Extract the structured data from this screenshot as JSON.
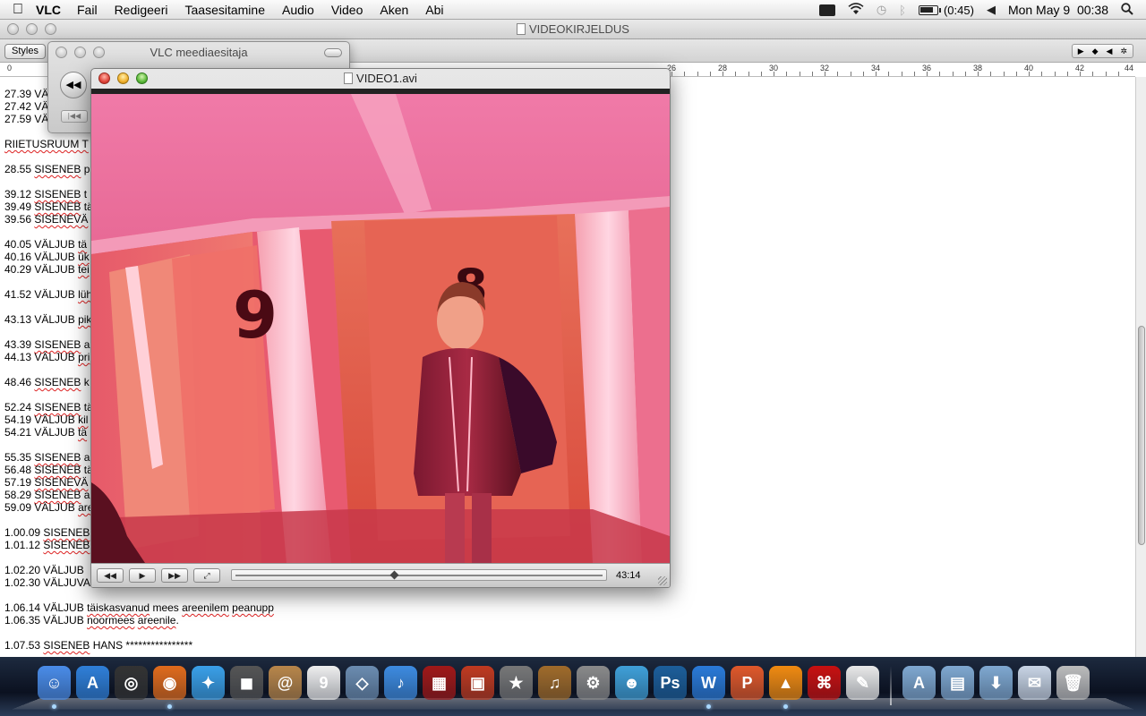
{
  "menubar": {
    "app_name": "VLC",
    "menus": [
      "Fail",
      "Redigeeri",
      "Taasesitamine",
      "Audio",
      "Video",
      "Aken",
      "Abi"
    ],
    "battery": "(0:45)",
    "clock": "Mon May 9  00:38",
    "icons": [
      "apple-icon",
      "keyboard-icon",
      "wifi-icon",
      "time-machine-icon",
      "bluetooth-icon",
      "battery-icon",
      "volume-icon",
      "spotlight-icon"
    ]
  },
  "doc_window": {
    "title": "VIDEOKIRJELDUS",
    "styles_label": "Styles",
    "ruler_numbers": [
      "0",
      "26",
      "28",
      "30",
      "32",
      "34",
      "36",
      "38",
      "40",
      "42",
      "44"
    ],
    "lines": [
      [
        {
          "t": "27.39 VÄ"
        }
      ],
      [
        {
          "t": "27.42 VÄ"
        }
      ],
      [
        {
          "t": "27.59 VÄ"
        }
      ],
      [],
      [
        {
          "t": "RIIETUSRUUM T",
          "sp": true
        }
      ],
      [],
      [
        {
          "t": "28.55 "
        },
        {
          "t": "SISENEB",
          "sp": true
        },
        {
          "t": " p"
        }
      ],
      [],
      [
        {
          "t": "39.12 "
        },
        {
          "t": "SISENEB",
          "sp": true
        },
        {
          "t": " t"
        }
      ],
      [
        {
          "t": "39.49 "
        },
        {
          "t": "SISENEB",
          "sp": true
        },
        {
          "t": " tä"
        }
      ],
      [
        {
          "t": "39.56 "
        },
        {
          "t": "SISENEVÄ",
          "sp": true
        }
      ],
      [],
      [
        {
          "t": "40.05 VÄLJUB "
        },
        {
          "t": "tä",
          "sp": true
        }
      ],
      [
        {
          "t": "40.16 VÄLJUB "
        },
        {
          "t": "ük",
          "sp": true
        }
      ],
      [
        {
          "t": "40.29 VÄLJUB "
        },
        {
          "t": "tei",
          "sp": true
        }
      ],
      [],
      [
        {
          "t": "41.52 VÄLJUB "
        },
        {
          "t": "lüh",
          "sp": true
        }
      ],
      [],
      [
        {
          "t": "43.13 VÄLJUB "
        },
        {
          "t": "pik",
          "sp": true
        }
      ],
      [],
      [
        {
          "t": "43.39 "
        },
        {
          "t": "SISENEB",
          "sp": true
        },
        {
          "t": " a"
        }
      ],
      [
        {
          "t": "44.13 VÄLJUB "
        },
        {
          "t": "pri",
          "sp": true
        }
      ],
      [],
      [
        {
          "t": "48.46 "
        },
        {
          "t": "SISENEB",
          "sp": true
        },
        {
          "t": " k"
        }
      ],
      [],
      [
        {
          "t": "52.24 "
        },
        {
          "t": "SISENEB",
          "sp": true
        },
        {
          "t": " tä"
        }
      ],
      [
        {
          "t": "54.19 VÄLJUB "
        },
        {
          "t": "kil",
          "sp": true
        }
      ],
      [
        {
          "t": "54.21 VÄLJUB "
        },
        {
          "t": "tä",
          "sp": true
        }
      ],
      [],
      [
        {
          "t": "55.35 "
        },
        {
          "t": "SISENEB",
          "sp": true
        },
        {
          "t": " a"
        }
      ],
      [
        {
          "t": "56.48 "
        },
        {
          "t": "SISENEB",
          "sp": true
        },
        {
          "t": " tä"
        }
      ],
      [
        {
          "t": "57.19 "
        },
        {
          "t": "SISENEVÄ",
          "sp": true
        }
      ],
      [
        {
          "t": "58.29 "
        },
        {
          "t": "SISENEB",
          "sp": true
        },
        {
          "t": " a"
        }
      ],
      [
        {
          "t": "59.09 VÄLJUB "
        },
        {
          "t": "are",
          "sp": true
        }
      ],
      [],
      [
        {
          "t": "1.00.09 "
        },
        {
          "t": "SISENEB",
          "sp": true
        }
      ],
      [
        {
          "t": "1.01.12 "
        },
        {
          "t": "SISENEB",
          "sp": true
        }
      ],
      [],
      [
        {
          "t": "1.02.20 VÄLJUB "
        }
      ],
      [
        {
          "t": "1.02.30 VÄLJUVAD "
        }
      ],
      [],
      [
        {
          "t": "1.06.14 VÄLJUB "
        },
        {
          "t": "täiskasvanud",
          "sp": true
        },
        {
          "t": " mees "
        },
        {
          "t": "areenilem",
          "sp": true
        },
        {
          "t": " "
        },
        {
          "t": "peanupp",
          "sp": true
        }
      ],
      [
        {
          "t": "1.06.35 VÄLJUB "
        },
        {
          "t": "noormees",
          "sp": true
        },
        {
          "t": " "
        },
        {
          "t": "areenile",
          "sp": true
        },
        {
          "t": "."
        }
      ],
      [],
      [
        {
          "t": "1.07.53 "
        },
        {
          "t": "SISENEB",
          "sp": true
        },
        {
          "t": " HANS ****************"
        }
      ]
    ]
  },
  "vlc_controller": {
    "title": "VLC meediaesitaja",
    "rewind_glyph": "◀◀",
    "prev_glyph": "|◀◀"
  },
  "video_window": {
    "title": "VIDEO1.avi",
    "controls": {
      "rewind": "◀◀",
      "play": "▶",
      "forward": "▶▶",
      "fullscreen": "⤢",
      "time": "43:14",
      "position": 0.43
    },
    "scene": {
      "door_number_left": "9",
      "door_number_right": "8"
    }
  },
  "dock": {
    "items": [
      {
        "name": "finder",
        "color": "#4a8ce8",
        "glyph": "☺",
        "running": true
      },
      {
        "name": "app-store",
        "color": "#2f7fd8",
        "glyph": "A",
        "running": false
      },
      {
        "name": "dashboard",
        "color": "#333333",
        "glyph": "◎",
        "running": false
      },
      {
        "name": "firefox",
        "color": "#e06b1c",
        "glyph": "◉",
        "running": true
      },
      {
        "name": "safari",
        "color": "#3aa0e8",
        "glyph": "✦",
        "running": false
      },
      {
        "name": "facetime",
        "color": "#555555",
        "glyph": "◼",
        "running": false
      },
      {
        "name": "address-book",
        "color": "#b8864a",
        "glyph": "@",
        "running": false
      },
      {
        "name": "ical",
        "color": "#eeeeee",
        "glyph": "9",
        "running": false
      },
      {
        "name": "iphoto",
        "color": "#6b8cb0",
        "glyph": "◇",
        "running": false
      },
      {
        "name": "itunes",
        "color": "#3d8be0",
        "glyph": "♪",
        "running": false
      },
      {
        "name": "dvd-player",
        "color": "#a01818",
        "glyph": "▦",
        "running": false
      },
      {
        "name": "photo-booth",
        "color": "#c03a20",
        "glyph": "▣",
        "running": false
      },
      {
        "name": "imovie",
        "color": "#777777",
        "glyph": "★",
        "running": false
      },
      {
        "name": "garageband",
        "color": "#a06b2a",
        "glyph": "♫",
        "running": false
      },
      {
        "name": "system-preferences",
        "color": "#8a8a8a",
        "glyph": "⚙",
        "running": false
      },
      {
        "name": "messenger",
        "color": "#3fa0d8",
        "glyph": "☻",
        "running": false
      },
      {
        "name": "photoshop",
        "color": "#1c5e9a",
        "glyph": "Ps",
        "running": false
      },
      {
        "name": "word",
        "color": "#2a7ad8",
        "glyph": "W",
        "running": true
      },
      {
        "name": "powerpoint",
        "color": "#e0582a",
        "glyph": "P",
        "running": false
      },
      {
        "name": "vlc",
        "color": "#f08a10",
        "glyph": "▲",
        "running": true
      },
      {
        "name": "acrobat",
        "color": "#c81010",
        "glyph": "⌘",
        "running": false
      },
      {
        "name": "textedit",
        "color": "#e8e8e8",
        "glyph": "✎",
        "running": false
      }
    ],
    "right_items": [
      {
        "name": "applications-folder",
        "color": "#7fa8d0",
        "glyph": "A"
      },
      {
        "name": "documents-folder",
        "color": "#7fa8d0",
        "glyph": "▤"
      },
      {
        "name": "downloads-folder",
        "color": "#7fa8d0",
        "glyph": "⬇"
      },
      {
        "name": "mail-stack",
        "color": "#c8d4e4",
        "glyph": "✉"
      },
      {
        "name": "trash",
        "color": "#bcbcbc",
        "glyph": "🗑"
      }
    ]
  }
}
